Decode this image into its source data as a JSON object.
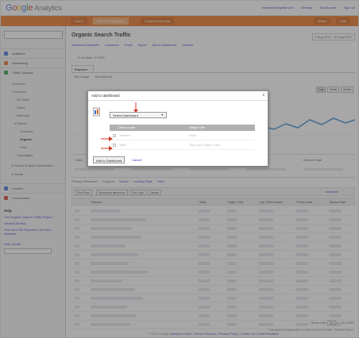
{
  "header": {
    "logo_text": "Google",
    "logo_suffix": "Analytics",
    "links": [
      "bruteforce@gmail.com",
      "Settings",
      "My Account",
      "Sign out"
    ]
  },
  "nav": {
    "tabs": [
      "Home",
      "Standard Reporting",
      "Custom Reporting"
    ],
    "active_tab": "Standard Reporting",
    "right_tabs": [
      "Admin",
      "Help"
    ]
  },
  "sidebar": {
    "items": [
      {
        "label": "Audience",
        "color": "#3b6dd8"
      },
      {
        "label": "Advertising",
        "color": "#e8711c"
      },
      {
        "label": "Traffic Sources",
        "color": "#2a9b3a"
      }
    ],
    "subitems": [
      "Overview",
      "Sources",
      "All Traffic",
      "Direct",
      "Referrals",
      "Search",
      "Overview",
      "Organic",
      "Paid",
      "Campaigns",
      "Search Engine Optimization",
      "Social"
    ],
    "lower_items": [
      {
        "label": "Content",
        "color": "#3b6dd8"
      },
      {
        "label": "Conversions",
        "color": "#d0392b"
      }
    ],
    "help": {
      "heading": "Help",
      "links": [
        "The Organic Search Traffic Report",
        "Viewing Metrics",
        "Find Your Old Reports in the New Interface"
      ],
      "center_label": "Help Center"
    }
  },
  "main": {
    "title": "Organic Search Traffic",
    "date_range": "1 Aug 2012 - 31 Aug 2012",
    "toolbar": [
      "Advanced Segments",
      "Customize",
      "Email",
      "Export",
      "Add to Dashboard",
      "Shortcut"
    ],
    "visits_note": "% of visits: 47.33%",
    "explore_tab": "Explorer",
    "explore_links": [
      "Site Usage",
      "Ecommerce"
    ],
    "chart_controls": [
      "Day",
      "Week",
      "Month"
    ],
    "active_control": "Day",
    "metrics": [
      "Visits",
      "Pages / Visit",
      "Avg. Visit Duration",
      "% New Visits",
      "Bounce Rate"
    ],
    "dims_label": "Primary Dimension:",
    "dims": [
      "Keyword",
      "Source",
      "Landing Page",
      "Other"
    ],
    "filter_buttons": [
      "Plot Rows",
      "Secondary dimension",
      "Sort Type",
      "Default"
    ],
    "advanced": "advanced",
    "table_headers": [
      "Keyword",
      "Visits",
      "Pages / Visit",
      "Avg. Visit Duration",
      "% New Visits",
      "Bounce Rate"
    ],
    "row_count": 14,
    "pager_label": "Show rows:",
    "pager_value": "10",
    "pager_range": "1 - 10 of 383",
    "footer_note": "This report was generated on 9/6/12 at 11:25:01 AM - Refresh Report",
    "copyright": "© 2012 Google",
    "copyright_links": [
      "Analytics Home",
      "Terms of Service",
      "Privacy Policy",
      "Contact Us",
      "Send Feedback"
    ]
  },
  "dialog": {
    "title": "Add to dashboard",
    "close": "x",
    "select_value": "Select Dashboard",
    "table_headers": [
      "Check to add",
      "Widget Title"
    ],
    "rows": [
      {
        "name": "Timeline",
        "title": "Visits"
      },
      {
        "name": "Table",
        "title": "Visits and Pages / Visit"
      }
    ],
    "add_button": "Add to Dashboard",
    "cancel": "Cancel"
  },
  "colors": {
    "nav_orange": "#e8711c",
    "chart_line": "#3a87c8",
    "annotation_arrow": "#d0392b"
  }
}
